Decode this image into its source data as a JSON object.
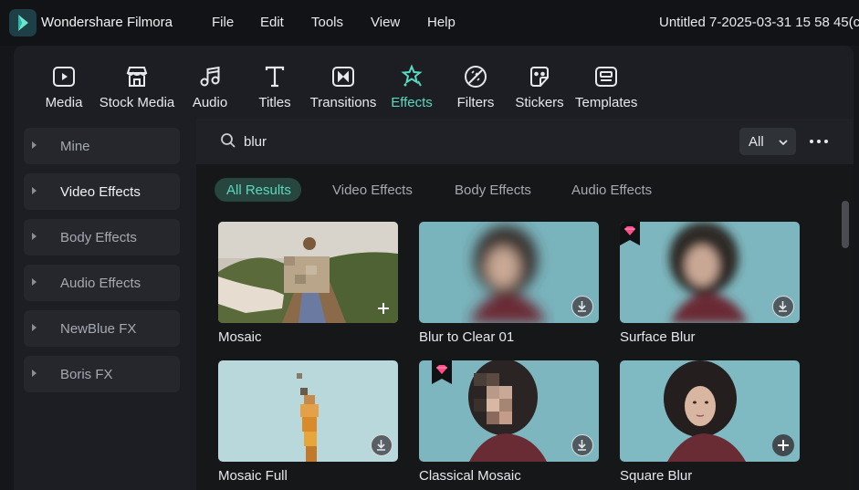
{
  "titlebar": {
    "app_name": "Wondershare Filmora",
    "menu": [
      "File",
      "Edit",
      "Tools",
      "View",
      "Help"
    ],
    "document_title": "Untitled 7-2025-03-31 15 58 45(c"
  },
  "toolbar": [
    {
      "label": "Media",
      "icon": "media-icon"
    },
    {
      "label": "Stock Media",
      "icon": "stock-media-icon"
    },
    {
      "label": "Audio",
      "icon": "audio-icon"
    },
    {
      "label": "Titles",
      "icon": "titles-icon"
    },
    {
      "label": "Transitions",
      "icon": "transitions-icon"
    },
    {
      "label": "Effects",
      "icon": "effects-icon",
      "active": true
    },
    {
      "label": "Filters",
      "icon": "filters-icon"
    },
    {
      "label": "Stickers",
      "icon": "stickers-icon"
    },
    {
      "label": "Templates",
      "icon": "templates-icon"
    }
  ],
  "sidebar": {
    "items": [
      "Mine",
      "Video Effects",
      "Body Effects",
      "Audio Effects",
      "NewBlue FX",
      "Boris FX"
    ],
    "selected": "Video Effects"
  },
  "search": {
    "query": "blur",
    "filter_value": "All"
  },
  "filter_tabs": [
    "All Results",
    "Video Effects",
    "Body Effects",
    "Audio Effects"
  ],
  "active_filter_tab": "All Results",
  "results": [
    {
      "title": "Mosaic",
      "action": "add",
      "premium": false
    },
    {
      "title": "Blur to Clear 01",
      "action": "download",
      "premium": false
    },
    {
      "title": "Surface Blur",
      "action": "download",
      "premium": true
    },
    {
      "title": "Mosaic Full",
      "action": "download",
      "premium": false
    },
    {
      "title": "Classical Mosaic",
      "action": "download",
      "premium": true
    },
    {
      "title": "Square Blur",
      "action": "add",
      "premium": false
    }
  ],
  "colors": {
    "accent": "#59d9bf",
    "background": "#151619",
    "panel": "#1c1e23",
    "premium_badge": "#ff4d8a"
  }
}
